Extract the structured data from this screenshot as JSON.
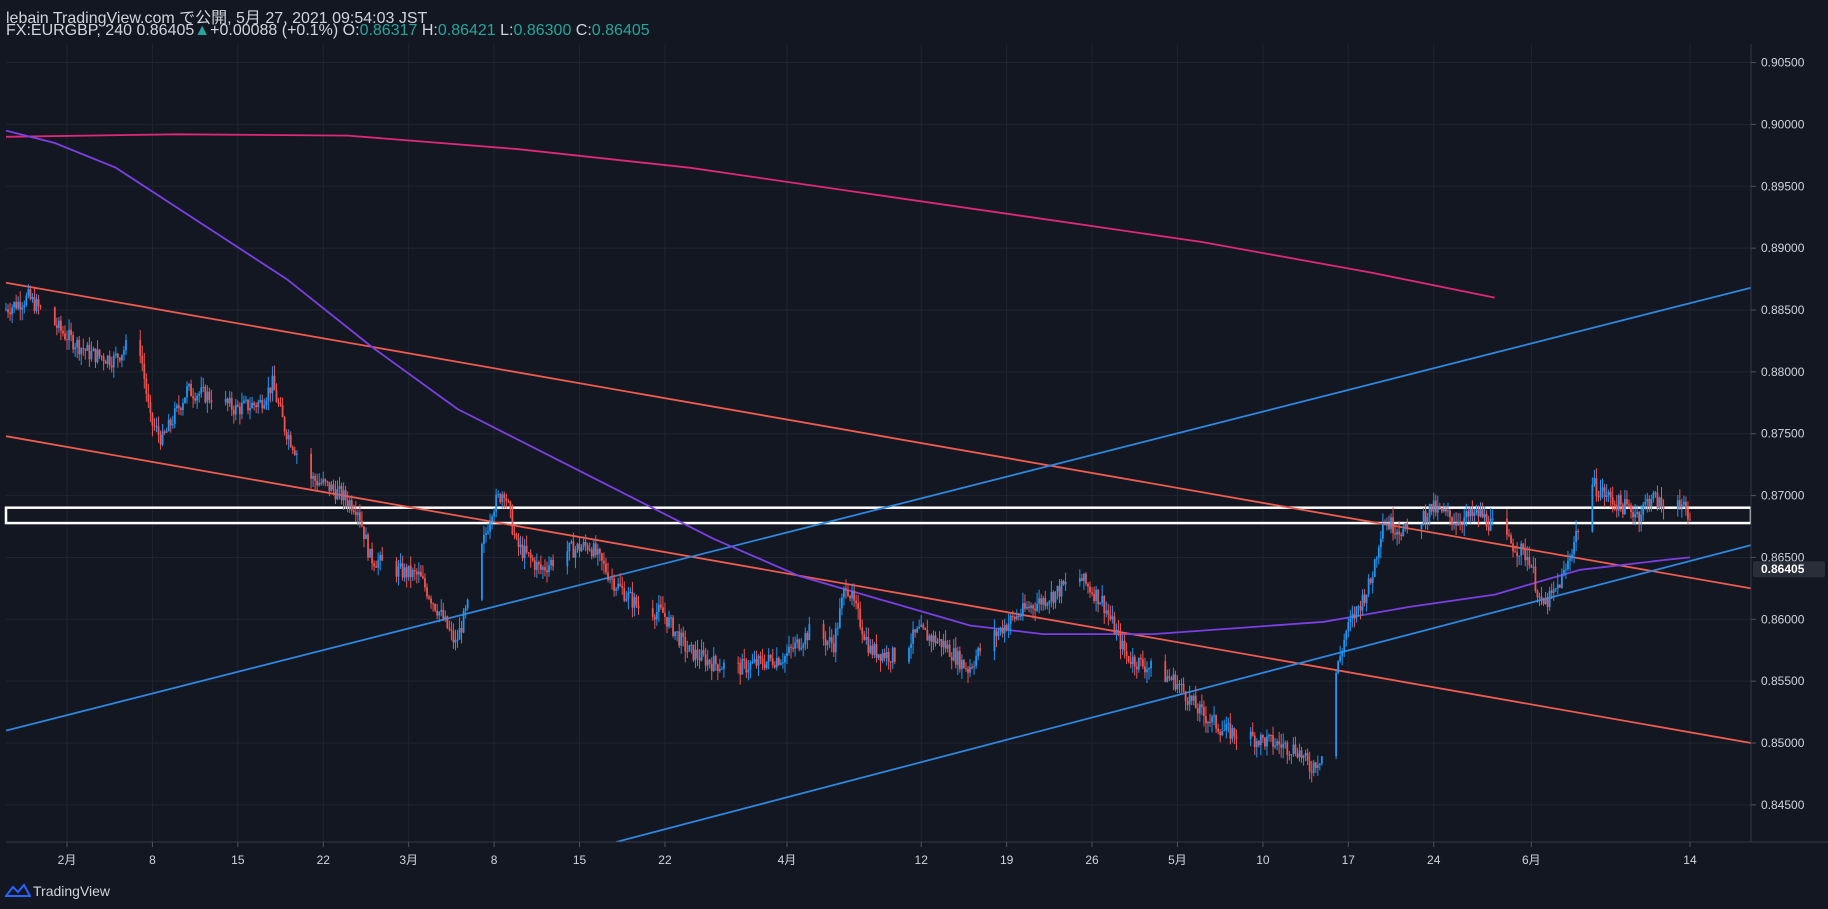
{
  "header": {
    "publish_line": "lebain TradingView.com で公開, 5月 27, 2021 09:54:03 JST",
    "symbol": "FX:EURGBP, 240",
    "last": "0.86405",
    "change_arrow": "▲",
    "change": "+0.00088 (+0.1%)",
    "o_label": "O:",
    "o_value": "0.86317",
    "h_label": "H:",
    "h_value": "0.86421",
    "l_label": "L:",
    "l_value": "0.86300",
    "c_label": "C:",
    "c_value": "0.86405"
  },
  "footer": {
    "brand": "TradingView"
  },
  "colors": {
    "background": "#131722",
    "grid": "#1f2430",
    "axis_text": "#d1d4dc",
    "candle_up": "#2196f3",
    "candle_down": "#ef5350",
    "channel_red": "#f05b4f",
    "channel_blue": "#2e86de",
    "ma_long": "#e0287a",
    "ma_mid": "#7b3fe4",
    "zone": "#ffffff",
    "value_accent": "#26a69a"
  },
  "chart_data": {
    "type": "candlestick",
    "symbol": "FX:EURGBP",
    "timeframe": "240",
    "ylim": [
      0.842,
      0.9065
    ],
    "xlim": [
      "2021-01-27",
      "2021-06-19"
    ],
    "y_ticks": [
      "0.84500",
      "0.85000",
      "0.85500",
      "0.86000",
      "0.86500",
      "0.87000",
      "0.87500",
      "0.88000",
      "0.88500",
      "0.89000",
      "0.89500",
      "0.90000",
      "0.90500"
    ],
    "current_price_label": "0.86405",
    "x_ticks": [
      {
        "label": "2月",
        "date": "2021-02-01"
      },
      {
        "label": "8",
        "date": "2021-02-08"
      },
      {
        "label": "15",
        "date": "2021-02-15"
      },
      {
        "label": "22",
        "date": "2021-02-22"
      },
      {
        "label": "3月",
        "date": "2021-03-01"
      },
      {
        "label": "8",
        "date": "2021-03-08"
      },
      {
        "label": "15",
        "date": "2021-03-15"
      },
      {
        "label": "22",
        "date": "2021-03-22"
      },
      {
        "label": "4月",
        "date": "2021-04-01"
      },
      {
        "label": "12",
        "date": "2021-04-12"
      },
      {
        "label": "19",
        "date": "2021-04-19"
      },
      {
        "label": "26",
        "date": "2021-04-26"
      },
      {
        "label": "5月",
        "date": "2021-05-03"
      },
      {
        "label": "10",
        "date": "2021-05-10"
      },
      {
        "label": "17",
        "date": "2021-05-17"
      },
      {
        "label": "24",
        "date": "2021-05-24"
      },
      {
        "label": "6月",
        "date": "2021-06-01"
      },
      {
        "label": "14",
        "date": "2021-06-14"
      }
    ],
    "price_path": [
      [
        "2021-01-27",
        0.885
      ],
      [
        "2021-01-29",
        0.886
      ],
      [
        "2021-02-01",
        0.883
      ],
      [
        "2021-02-03",
        0.8815
      ],
      [
        "2021-02-05",
        0.881
      ],
      [
        "2021-02-07",
        0.883
      ],
      [
        "2021-02-08",
        0.876
      ],
      [
        "2021-02-09",
        0.8745
      ],
      [
        "2021-02-11",
        0.8785
      ],
      [
        "2021-02-13",
        0.878
      ],
      [
        "2021-02-15",
        0.877
      ],
      [
        "2021-02-17",
        0.8775
      ],
      [
        "2021-02-18",
        0.879
      ],
      [
        "2021-02-19",
        0.8755
      ],
      [
        "2021-02-21",
        0.8715
      ],
      [
        "2021-02-23",
        0.8705
      ],
      [
        "2021-02-25",
        0.869
      ],
      [
        "2021-02-26",
        0.865
      ],
      [
        "2021-02-28",
        0.864
      ],
      [
        "2021-03-02",
        0.8635
      ],
      [
        "2021-03-04",
        0.86
      ],
      [
        "2021-03-05",
        0.858
      ],
      [
        "2021-03-06",
        0.861
      ],
      [
        "2021-03-08",
        0.869
      ],
      [
        "2021-03-09",
        0.8705
      ],
      [
        "2021-03-10",
        0.866
      ],
      [
        "2021-03-12",
        0.864
      ],
      [
        "2021-03-14",
        0.8655
      ],
      [
        "2021-03-16",
        0.866
      ],
      [
        "2021-03-18",
        0.863
      ],
      [
        "2021-03-20",
        0.861
      ],
      [
        "2021-03-22",
        0.8605
      ],
      [
        "2021-03-24",
        0.8575
      ],
      [
        "2021-03-26",
        0.8565
      ],
      [
        "2021-03-28",
        0.856
      ],
      [
        "2021-03-30",
        0.8565
      ],
      [
        "2021-04-01",
        0.857
      ],
      [
        "2021-04-03",
        0.859
      ],
      [
        "2021-04-05",
        0.858
      ],
      [
        "2021-04-06",
        0.863
      ],
      [
        "2021-04-08",
        0.8575
      ],
      [
        "2021-04-10",
        0.857
      ],
      [
        "2021-04-12",
        0.859
      ],
      [
        "2021-04-14",
        0.858
      ],
      [
        "2021-04-16",
        0.856
      ],
      [
        "2021-04-17",
        0.8575
      ],
      [
        "2021-04-19",
        0.8595
      ],
      [
        "2021-04-21",
        0.861
      ],
      [
        "2021-04-23",
        0.862
      ],
      [
        "2021-04-25",
        0.8635
      ],
      [
        "2021-04-27",
        0.8615
      ],
      [
        "2021-04-29",
        0.857
      ],
      [
        "2021-05-01",
        0.856
      ],
      [
        "2021-05-03",
        0.855
      ],
      [
        "2021-05-05",
        0.8525
      ],
      [
        "2021-05-07",
        0.851
      ],
      [
        "2021-05-09",
        0.8505
      ],
      [
        "2021-05-11",
        0.85
      ],
      [
        "2021-05-13",
        0.8495
      ],
      [
        "2021-05-14",
        0.848
      ],
      [
        "2021-05-15",
        0.849
      ],
      [
        "2021-05-16",
        0.855
      ],
      [
        "2021-05-17",
        0.859
      ],
      [
        "2021-05-19",
        0.863
      ],
      [
        "2021-05-20",
        0.868
      ],
      [
        "2021-05-22",
        0.867
      ],
      [
        "2021-05-24",
        0.869
      ],
      [
        "2021-05-26",
        0.868
      ],
      [
        "2021-05-28",
        0.8685
      ],
      [
        "2021-05-30",
        0.8665
      ],
      [
        "2021-06-01",
        0.865
      ],
      [
        "2021-06-02",
        0.861
      ],
      [
        "2021-06-03",
        0.862
      ],
      [
        "2021-06-04",
        0.864
      ],
      [
        "2021-06-05",
        0.8675
      ],
      [
        "2021-06-06",
        0.871
      ],
      [
        "2021-06-08",
        0.8695
      ],
      [
        "2021-06-10",
        0.8685
      ],
      [
        "2021-06-11",
        0.87
      ],
      [
        "2021-06-12",
        0.869
      ],
      [
        "2021-06-13",
        0.8705
      ],
      [
        "2021-06-14",
        0.868
      ]
    ],
    "lines": [
      {
        "name": "",
        "color_key": "channel_red",
        "from": [
          "2021-01-27",
          0.8872
        ],
        "to": [
          "2021-06-19",
          0.8625
        ]
      },
      {
        "name": "",
        "color_key": "channel_red",
        "from": [
          "2021-01-27",
          0.8748
        ],
        "to": [
          "2021-06-19",
          0.85
        ]
      },
      {
        "name": "",
        "color_key": "channel_blue",
        "from": [
          "2021-01-27",
          0.851
        ],
        "to": [
          "2021-06-19",
          0.8868
        ]
      },
      {
        "name": "",
        "color_key": "channel_blue",
        "from": [
          "2021-03-18",
          0.842
        ],
        "to": [
          "2021-06-19",
          0.866
        ]
      }
    ],
    "zone": {
      "top": 0.8689,
      "bottom": 0.8679
    },
    "ma_long": [
      [
        "2021-01-27",
        0.899
      ],
      [
        "2021-02-10",
        0.8992
      ],
      [
        "2021-02-24",
        0.8991
      ],
      [
        "2021-03-10",
        0.898
      ],
      [
        "2021-03-24",
        0.8965
      ],
      [
        "2021-04-07",
        0.8945
      ],
      [
        "2021-04-21",
        0.8925
      ],
      [
        "2021-05-05",
        0.8905
      ],
      [
        "2021-05-19",
        0.888
      ],
      [
        "2021-05-29",
        0.886
      ]
    ],
    "ma_mid": [
      [
        "2021-01-27",
        0.8995
      ],
      [
        "2021-01-31",
        0.8985
      ],
      [
        "2021-02-05",
        0.8965
      ],
      [
        "2021-02-12",
        0.892
      ],
      [
        "2021-02-19",
        0.8875
      ],
      [
        "2021-02-26",
        0.882
      ],
      [
        "2021-03-05",
        0.877
      ],
      [
        "2021-03-12",
        0.8735
      ],
      [
        "2021-03-19",
        0.87
      ],
      [
        "2021-03-26",
        0.8665
      ],
      [
        "2021-04-02",
        0.8635
      ],
      [
        "2021-04-09",
        0.8615
      ],
      [
        "2021-04-16",
        0.8595
      ],
      [
        "2021-04-22",
        0.8588
      ],
      [
        "2021-05-01",
        0.8588
      ],
      [
        "2021-05-08",
        0.8593
      ],
      [
        "2021-05-15",
        0.8598
      ],
      [
        "2021-05-22",
        0.861
      ],
      [
        "2021-05-29",
        0.862
      ],
      [
        "2021-06-05",
        0.864
      ],
      [
        "2021-06-12",
        0.8648
      ],
      [
        "2021-06-14",
        0.865
      ]
    ]
  }
}
